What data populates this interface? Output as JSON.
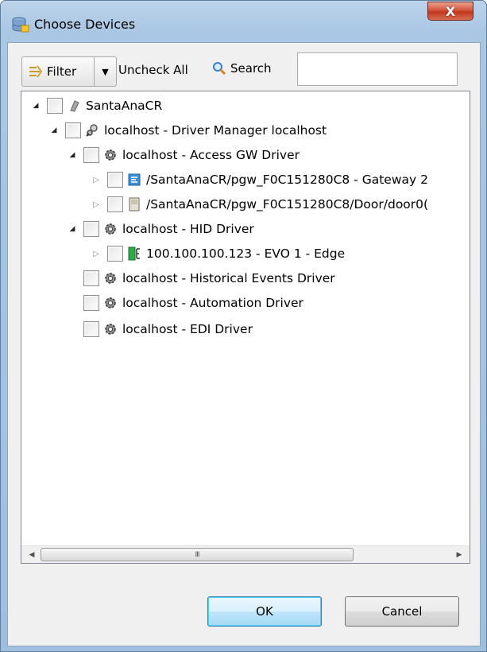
{
  "window": {
    "title": "Choose Devices",
    "close_label": "X"
  },
  "toolbar": {
    "filter_label": "Filter",
    "uncheck_all_label": "Uncheck All",
    "search_label": "Search",
    "search_value": ""
  },
  "tree": {
    "nodes": [
      {
        "label": "SantaAnaCR",
        "icon": "server-icon",
        "expander": "open"
      },
      {
        "label": "localhost - Driver Manager localhost",
        "icon": "driver-manager-icon",
        "expander": "open"
      },
      {
        "label": "localhost - Access GW Driver",
        "icon": "gear-icon",
        "expander": "open"
      },
      {
        "label": "/SantaAnaCR/pgw_F0C151280C8 - Gateway  2",
        "icon": "gateway-icon",
        "expander": "closed"
      },
      {
        "label": "/SantaAnaCR/pgw_F0C151280C8/Door/door0(",
        "icon": "door-icon",
        "expander": "closed"
      },
      {
        "label": "localhost - HID Driver",
        "icon": "gear-icon",
        "expander": "open"
      },
      {
        "label": "100.100.100.123 - EVO 1 - Edge",
        "icon": "edge-device-icon",
        "expander": "closed"
      },
      {
        "label": "localhost - Historical Events Driver",
        "icon": "gear-icon",
        "expander": "none"
      },
      {
        "label": "localhost - Automation Driver",
        "icon": "gear-icon",
        "expander": "none"
      },
      {
        "label": "localhost - EDI Driver",
        "icon": "gear-icon",
        "expander": "none"
      }
    ]
  },
  "scrollbar": {
    "thumb_grip": "III"
  },
  "footer": {
    "ok_label": "OK",
    "cancel_label": "Cancel"
  }
}
